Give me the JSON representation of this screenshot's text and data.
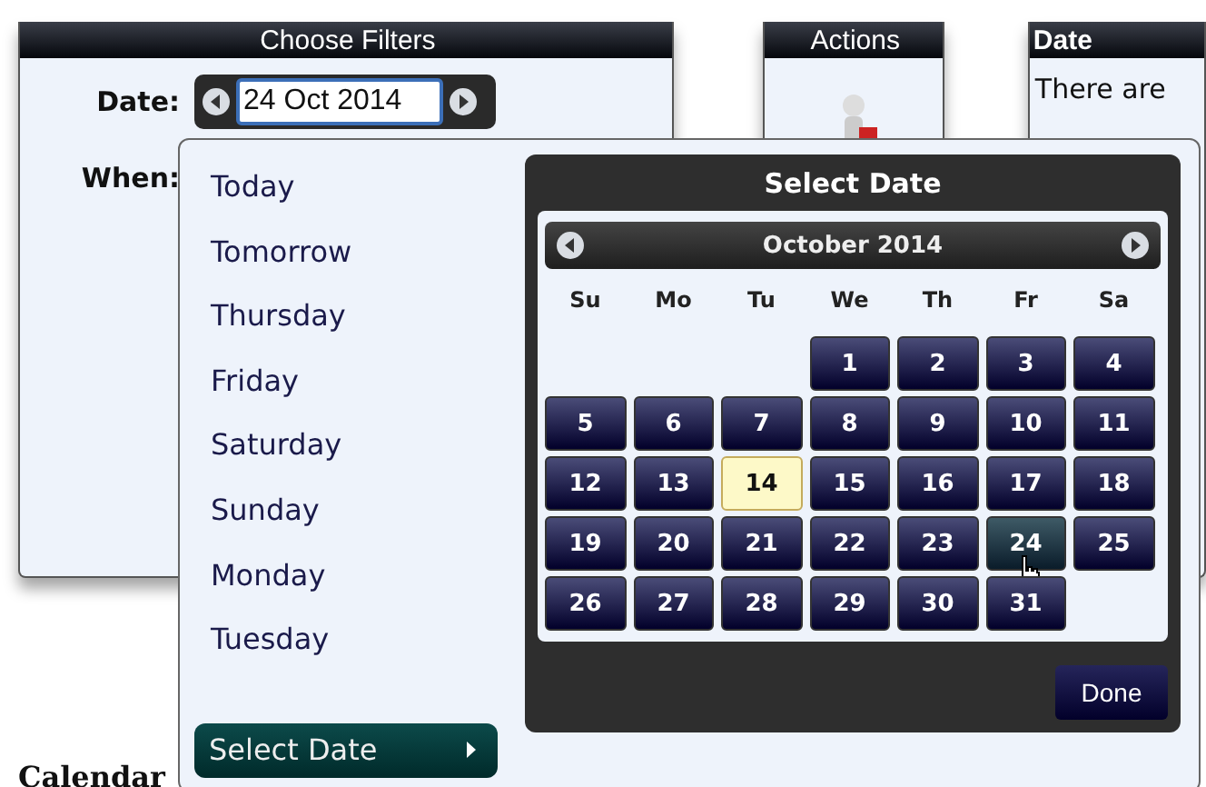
{
  "filters_panel": {
    "title": "Choose Filters",
    "date_label": "Date:",
    "date_value": "24 Oct 2014",
    "when_label": "When:"
  },
  "actions_panel": {
    "title": "Actions"
  },
  "date_panel": {
    "title": "Date",
    "text": "There are"
  },
  "calendar_heading": "Calendar",
  "when_menu": {
    "options": [
      {
        "label": "Today",
        "selected": false
      },
      {
        "label": "Tomorrow",
        "selected": false
      },
      {
        "label": "Thursday",
        "selected": false
      },
      {
        "label": "Friday",
        "selected": false
      },
      {
        "label": "Saturday",
        "selected": false
      },
      {
        "label": "Sunday",
        "selected": false
      },
      {
        "label": "Monday",
        "selected": false
      },
      {
        "label": "Tuesday",
        "selected": false
      },
      {
        "label": "Select Date",
        "selected": true
      }
    ]
  },
  "date_picker": {
    "title": "Select Date",
    "month": "October 2014",
    "weekdays": [
      "Su",
      "Mo",
      "Tu",
      "We",
      "Th",
      "Fr",
      "Sa"
    ],
    "days": [
      {
        "kind": "blank"
      },
      {
        "kind": "blank"
      },
      {
        "kind": "blank"
      },
      {
        "kind": "day",
        "label": "1",
        "today": false,
        "hover": false
      },
      {
        "kind": "day",
        "label": "2",
        "today": false,
        "hover": false
      },
      {
        "kind": "day",
        "label": "3",
        "today": false,
        "hover": false
      },
      {
        "kind": "day",
        "label": "4",
        "today": false,
        "hover": false
      },
      {
        "kind": "day",
        "label": "5",
        "today": false,
        "hover": false
      },
      {
        "kind": "day",
        "label": "6",
        "today": false,
        "hover": false
      },
      {
        "kind": "day",
        "label": "7",
        "today": false,
        "hover": false
      },
      {
        "kind": "day",
        "label": "8",
        "today": false,
        "hover": false
      },
      {
        "kind": "day",
        "label": "9",
        "today": false,
        "hover": false
      },
      {
        "kind": "day",
        "label": "10",
        "today": false,
        "hover": false
      },
      {
        "kind": "day",
        "label": "11",
        "today": false,
        "hover": false
      },
      {
        "kind": "day",
        "label": "12",
        "today": false,
        "hover": false
      },
      {
        "kind": "day",
        "label": "13",
        "today": false,
        "hover": false
      },
      {
        "kind": "day",
        "label": "14",
        "today": true,
        "hover": false
      },
      {
        "kind": "day",
        "label": "15",
        "today": false,
        "hover": false
      },
      {
        "kind": "day",
        "label": "16",
        "today": false,
        "hover": false
      },
      {
        "kind": "day",
        "label": "17",
        "today": false,
        "hover": false
      },
      {
        "kind": "day",
        "label": "18",
        "today": false,
        "hover": false
      },
      {
        "kind": "day",
        "label": "19",
        "today": false,
        "hover": false
      },
      {
        "kind": "day",
        "label": "20",
        "today": false,
        "hover": false
      },
      {
        "kind": "day",
        "label": "21",
        "today": false,
        "hover": false
      },
      {
        "kind": "day",
        "label": "22",
        "today": false,
        "hover": false
      },
      {
        "kind": "day",
        "label": "23",
        "today": false,
        "hover": false
      },
      {
        "kind": "day",
        "label": "24",
        "today": false,
        "hover": true
      },
      {
        "kind": "day",
        "label": "25",
        "today": false,
        "hover": false
      },
      {
        "kind": "day",
        "label": "26",
        "today": false,
        "hover": false
      },
      {
        "kind": "day",
        "label": "27",
        "today": false,
        "hover": false
      },
      {
        "kind": "day",
        "label": "28",
        "today": false,
        "hover": false
      },
      {
        "kind": "day",
        "label": "29",
        "today": false,
        "hover": false
      },
      {
        "kind": "day",
        "label": "30",
        "today": false,
        "hover": false
      },
      {
        "kind": "day",
        "label": "31",
        "today": false,
        "hover": false
      }
    ],
    "done": "Done"
  }
}
